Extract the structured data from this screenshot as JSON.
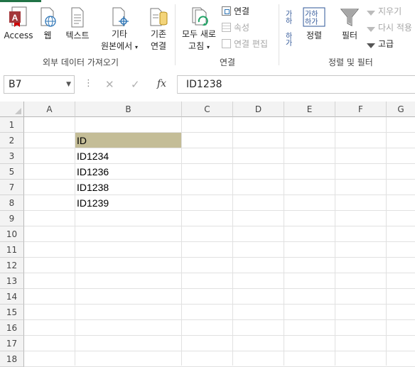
{
  "ribbon": {
    "get_external_data": {
      "access": "Access",
      "web": "웹",
      "text": "텍스트",
      "other_line1": "기타",
      "other_line2": "원본에서",
      "existing_line1": "기존",
      "existing_line2": "연결",
      "group_label": "외부 데이터 가져오기"
    },
    "connections": {
      "refresh_line1": "모두 새로",
      "refresh_line2": "고침",
      "connections": "연결",
      "properties": "속성",
      "edit_links": "연결 편집",
      "group_label": "연결"
    },
    "sort_filter": {
      "sort": "정렬",
      "filter": "필터",
      "clear": "지우기",
      "reapply": "다시 적용",
      "advanced": "고급",
      "group_label": "정렬 및 필터"
    }
  },
  "formula_bar": {
    "name_box": "B7",
    "fx": "fx",
    "content": "ID1238"
  },
  "grid": {
    "columns": [
      "A",
      "B",
      "C",
      "D",
      "E",
      "F",
      "G"
    ],
    "rows": [
      "1",
      "2",
      "3",
      "5",
      "7",
      "8",
      "9",
      "10",
      "11",
      "12",
      "13",
      "14",
      "15",
      "16",
      "17",
      "18"
    ],
    "cells_b": [
      "",
      "ID",
      "ID1234",
      "ID1236",
      "ID1238",
      "ID1239",
      "",
      "",
      "",
      "",
      "",
      "",
      "",
      "",
      "",
      ""
    ]
  },
  "colors": {
    "header_fill": "#c4bd97",
    "accent": "#217346"
  }
}
